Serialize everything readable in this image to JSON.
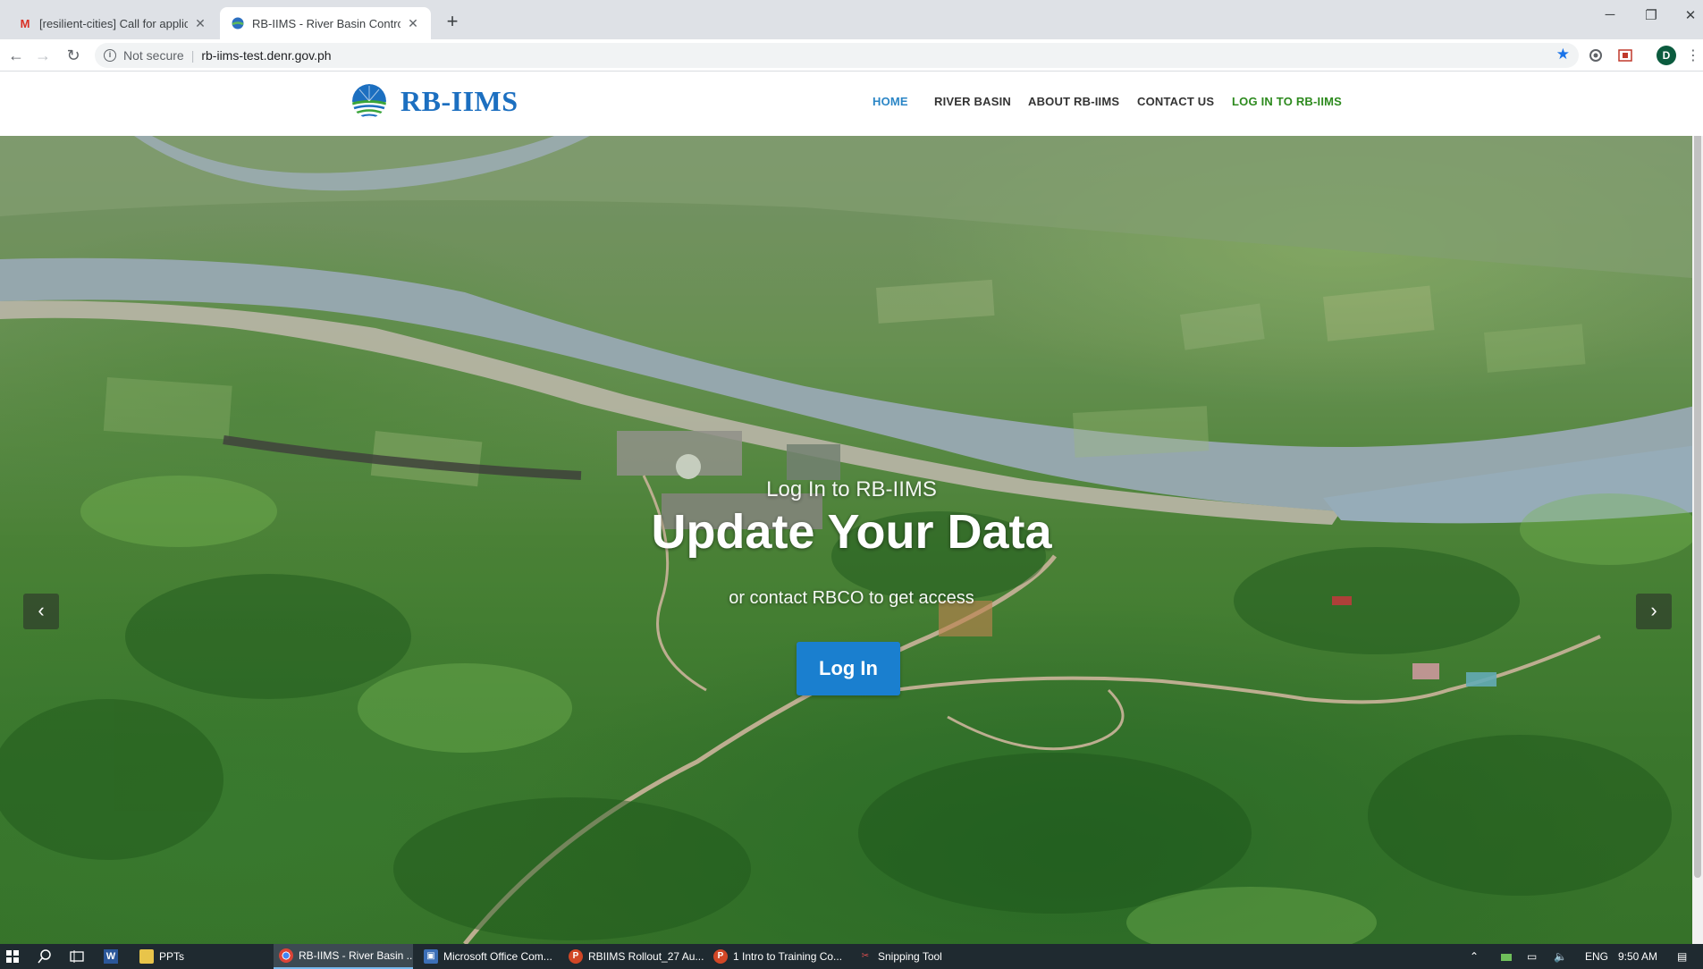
{
  "browser": {
    "tabs": [
      {
        "title": "[resilient-cities] Call for applicatio",
        "favicon": "gmail-icon",
        "active": false
      },
      {
        "title": "RB-IIMS - River Basin Control Offi",
        "favicon": "globe-icon",
        "active": true
      }
    ],
    "security_label": "Not secure",
    "url": "rb-iims-test.denr.gov.ph",
    "profile_initial": "D"
  },
  "site": {
    "brand": "RB-IIMS",
    "nav": [
      {
        "label": "HOME",
        "state": "active"
      },
      {
        "label": "RIVER BASIN",
        "state": "normal"
      },
      {
        "label": "ABOUT RB-IIMS",
        "state": "normal"
      },
      {
        "label": "CONTACT US",
        "state": "normal"
      },
      {
        "label": "LOG IN TO RB-IIMS",
        "state": "highlight"
      }
    ],
    "colors": {
      "brand": "#1c6fc0",
      "nav_active": "#2b86c6",
      "nav_login": "#2d8a1e",
      "button": "#1a7fcf"
    }
  },
  "hero": {
    "eyebrow": "Log In to RB-IIMS",
    "headline": "Update Your Data",
    "subtext": "or contact RBCO to get access",
    "button_label": "Log In",
    "prev_icon": "chevron-left-icon",
    "next_icon": "chevron-right-icon"
  },
  "taskbar": {
    "items": [
      {
        "label": "RB-IIMS - River Basin ...",
        "icon": "chrome-icon",
        "active": true
      },
      {
        "label": "Microsoft Office Com...",
        "icon": "office-icon",
        "active": false
      },
      {
        "label": "RBIIMS Rollout_27 Au...",
        "icon": "powerpoint-icon",
        "active": false
      },
      {
        "label": "1 Intro to Training Co...",
        "icon": "powerpoint-icon",
        "active": false
      },
      {
        "label": "Snipping Tool",
        "icon": "scissors-icon",
        "active": false
      }
    ],
    "pinned_folder": "PPTs",
    "language": "ENG",
    "time": "9:50 AM"
  }
}
